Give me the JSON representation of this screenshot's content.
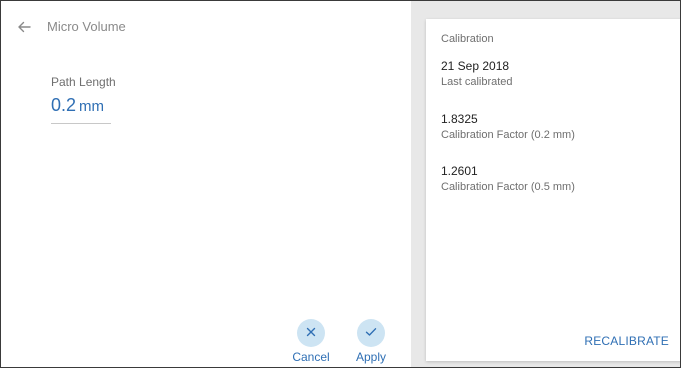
{
  "header": {
    "title": "Micro Volume"
  },
  "path_length": {
    "label": "Path Length",
    "value": "0.2",
    "unit": "mm"
  },
  "actions": {
    "cancel_label": "Cancel",
    "apply_label": "Apply"
  },
  "calibration": {
    "title": "Calibration",
    "entries": [
      {
        "value": "21 Sep 2018",
        "description": "Last calibrated"
      },
      {
        "value": "1.8325",
        "description": "Calibration Factor (0.2 mm)"
      },
      {
        "value": "1.2601",
        "description": "Calibration Factor (0.5 mm)"
      }
    ],
    "recalibrate_label": "RECALIBRATE"
  },
  "colors": {
    "accent": "#2f6fb4",
    "button_circle": "#cde4f3",
    "side_panel_bg": "#e8e8e8"
  },
  "icons": {
    "back": "back-arrow-icon",
    "cancel": "close-icon",
    "apply": "check-icon"
  }
}
